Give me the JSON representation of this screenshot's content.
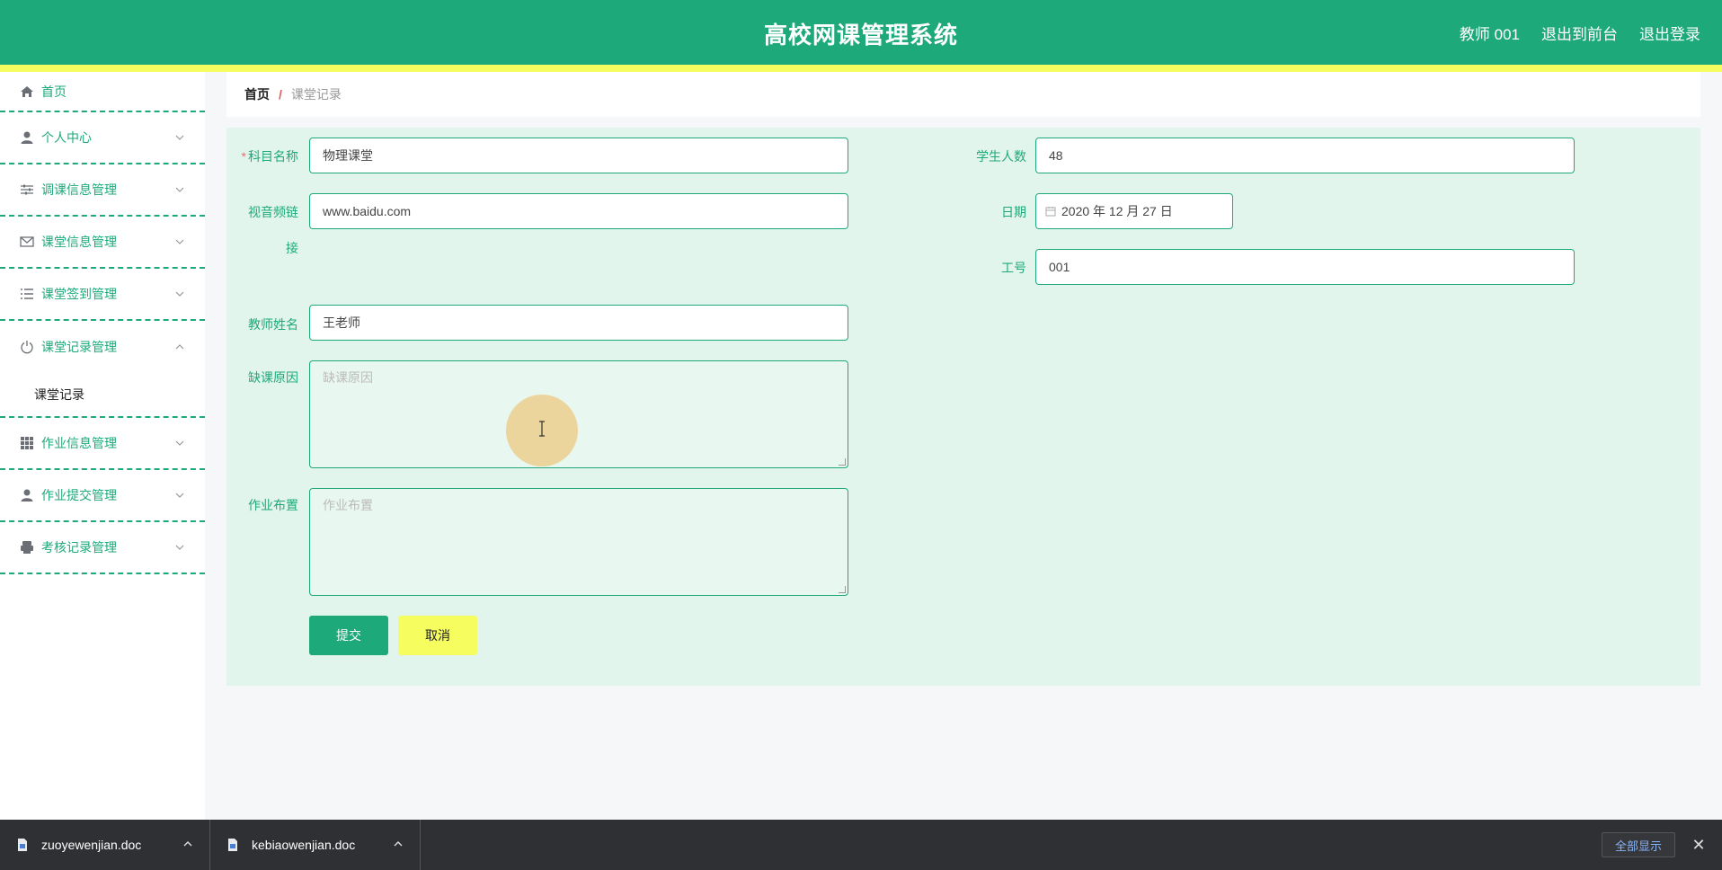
{
  "header": {
    "title": "高校网课管理系统",
    "user": "教师 001",
    "front_link": "退出到前台",
    "logout_link": "退出登录"
  },
  "sidebar": {
    "items": [
      {
        "label": "首页",
        "icon": "home-icon"
      },
      {
        "label": "个人中心",
        "icon": "user-icon"
      },
      {
        "label": "调课信息管理",
        "icon": "sliders-icon"
      },
      {
        "label": "课堂信息管理",
        "icon": "mail-icon"
      },
      {
        "label": "课堂签到管理",
        "icon": "list-icon"
      },
      {
        "label": "课堂记录管理",
        "icon": "power-icon",
        "expanded": true,
        "children": [
          {
            "label": "课堂记录"
          }
        ]
      },
      {
        "label": "作业信息管理",
        "icon": "grid-icon"
      },
      {
        "label": "作业提交管理",
        "icon": "user-icon"
      },
      {
        "label": "考核记录管理",
        "icon": "printer-icon"
      }
    ]
  },
  "breadcrumb": {
    "home": "首页",
    "separator": "/",
    "current": "课堂记录"
  },
  "form": {
    "subject": {
      "label": "科目名称",
      "required_mark": "*",
      "value": "物理课堂"
    },
    "video_link": {
      "label_line1": "视音频链",
      "label_line2": "接",
      "value": "www.baidu.com"
    },
    "teacher": {
      "label": "教师姓名",
      "value": "王老师"
    },
    "absence_reason": {
      "label": "缺课原因",
      "placeholder": "缺课原因"
    },
    "homework": {
      "label": "作业布置",
      "placeholder": "作业布置"
    },
    "student_count": {
      "label": "学生人数",
      "value": "48"
    },
    "date": {
      "label": "日期",
      "value": "2020 年 12 月 27 日"
    },
    "employee_id": {
      "label": "工号",
      "value": "001"
    },
    "submit_label": "提交",
    "cancel_label": "取消"
  },
  "downloads": {
    "files": [
      {
        "name": "zuoyewenjian.doc"
      },
      {
        "name": "kebiaowenjian.doc"
      }
    ],
    "show_all": "全部显示",
    "close": "✕"
  },
  "colors": {
    "primary": "#1ea97a",
    "accent_yellow": "#f6fd5f",
    "panel_bg": "#e2f5ed"
  }
}
